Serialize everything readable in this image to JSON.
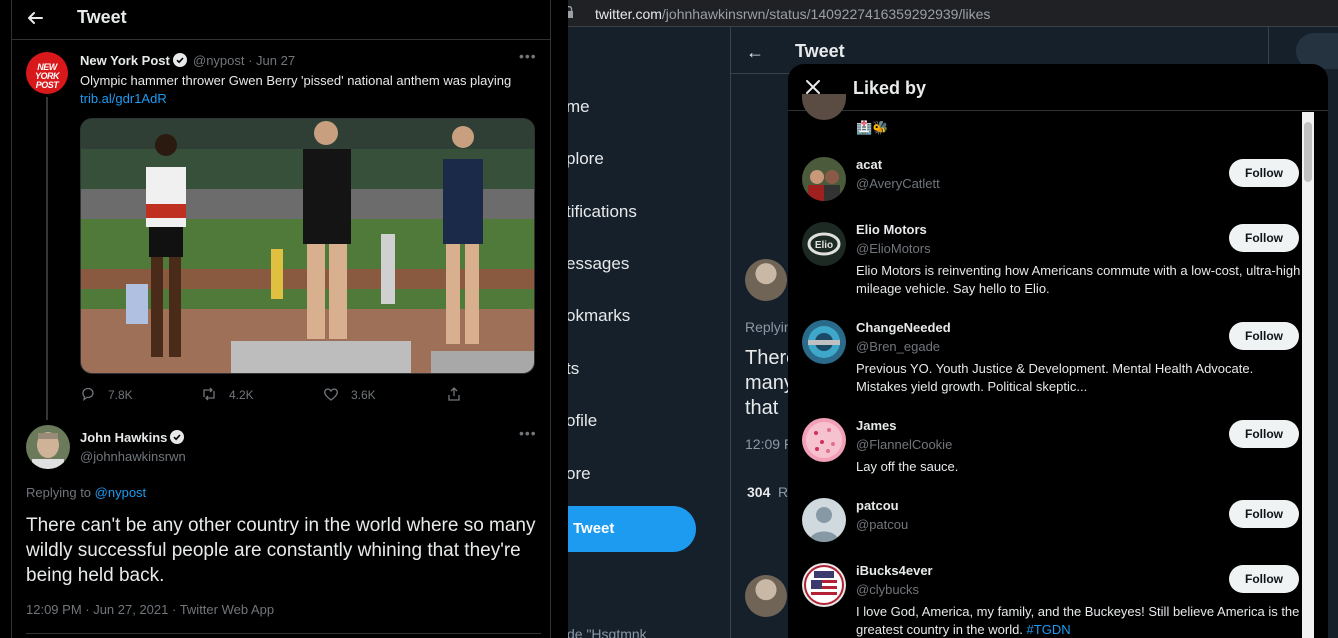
{
  "background_window": {
    "url_domain": "twitter.com",
    "url_path": "/johnhawkinsrwn/status/1409227416359292939/likes",
    "nav_items": [
      "me",
      "plore",
      "tifications",
      "essages",
      "okmarks",
      "ts",
      "ofile",
      "ore"
    ],
    "tweet_button": "Tweet",
    "header_title": "Tweet",
    "replying_partial": "Replying",
    "tweet_text_partial": [
      "There",
      "many",
      "that"
    ],
    "time_partial": "12:09 P",
    "likes_count_partial": "304",
    "likes_suffix_partial": "R",
    "bottom_partial": "de \"Hsgtmnk"
  },
  "modal": {
    "title": "Liked by",
    "top_partial_emoji": "🏥🐝",
    "likers": [
      {
        "name": "acat",
        "handle": "@AveryCatlett",
        "bio": "",
        "button": "Follow"
      },
      {
        "name": "Elio Motors",
        "handle": "@ElioMotors",
        "bio": "Elio Motors is reinventing how Americans commute with a low-cost, ultra-high mileage vehicle. Say hello to Elio.",
        "button": "Follow"
      },
      {
        "name": "ChangeNeeded",
        "handle": "@Bren_egade",
        "bio": "Previous YO. Youth Justice & Development. Mental Health Advocate. Mistakes yield growth. Political skeptic...",
        "button": "Follow"
      },
      {
        "name": "James",
        "handle": "@FlannelCookie",
        "bio": "Lay off the sauce.",
        "button": "Follow"
      },
      {
        "name": "patcou",
        "handle": "@patcou",
        "bio": "",
        "button": "Follow"
      },
      {
        "name": "iBucks4ever",
        "handle": "@clybucks",
        "bio": "I love God, America, my family, and the Buckeyes! Still believe America is the greatest country in the world.",
        "bio_hashtag": "#TGDN",
        "button": "Follow"
      }
    ]
  },
  "main": {
    "header_title": "Tweet",
    "quoted_tweet": {
      "avatar_text": "NEW YORK POST",
      "name": "New York Post",
      "handle_date": "@nypost · Jun 27",
      "text": "Olympic hammer thrower Gwen Berry 'pissed' national anthem was playing",
      "link": "trib.al/gdr1AdR",
      "replies": "7.8K",
      "retweets": "4.2K",
      "likes": "3.6K"
    },
    "reply": {
      "name": "John Hawkins",
      "handle": "@johnhawkinsrwn",
      "replying_label": "Replying to",
      "replying_mention": "@nypost",
      "text": "There can't be any other country in the world where so many wildly successful people are constantly whining that they're being held back.",
      "meta": "12:09 PM · Jun 27, 2021 · Twitter Web App"
    }
  },
  "colors": {
    "accent": "#1d9bf0",
    "bg_dim": "#15202b",
    "nyp_red": "#d9181b"
  }
}
